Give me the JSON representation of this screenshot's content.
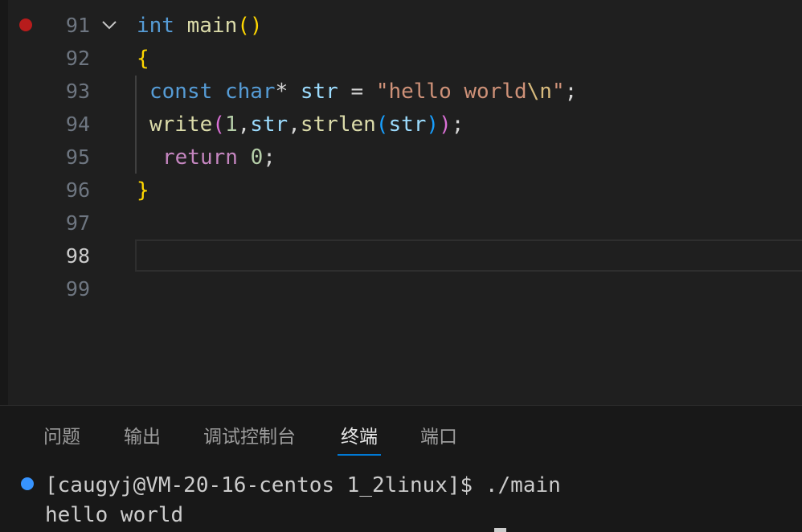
{
  "editor": {
    "lines": [
      {
        "number": "91",
        "tokens": [
          "int",
          "main",
          "(",
          ")"
        ]
      },
      {
        "number": "92",
        "tokens": [
          "{"
        ]
      },
      {
        "number": "93",
        "tokens": [
          "const",
          "char",
          "*",
          "str",
          "=",
          "\"hello world",
          "\\n",
          "\"",
          ";"
        ]
      },
      {
        "number": "94",
        "tokens": [
          "write",
          "(",
          "1",
          ",",
          "str",
          ",",
          "strlen",
          "(",
          "str",
          ")",
          ")",
          ";"
        ]
      },
      {
        "number": "95",
        "tokens": [
          "return",
          "0",
          ";"
        ]
      },
      {
        "number": "96",
        "tokens": [
          "}"
        ]
      },
      {
        "number": "97",
        "tokens": []
      },
      {
        "number": "98",
        "tokens": []
      },
      {
        "number": "99",
        "tokens": []
      }
    ],
    "active_line": "98",
    "breakpoint_line": "91",
    "folding_icon": "chevron-down-icon"
  },
  "panel": {
    "tabs": [
      {
        "label": "问题",
        "active": false
      },
      {
        "label": "输出",
        "active": false
      },
      {
        "label": "调试控制台",
        "active": false
      },
      {
        "label": "终端",
        "active": true
      }
    ],
    "extra_tab": "端口",
    "terminal": {
      "prompt": "[caugyj@VM-20-16-centos 1_2linux]$ ./main",
      "output": "hello world"
    }
  },
  "colors": {
    "editor_bg": "#1f1f1f",
    "panel_bg": "#181818",
    "accent": "#0078d4",
    "breakpoint": "#b71c1c",
    "terminal_status": "#3794ff"
  }
}
